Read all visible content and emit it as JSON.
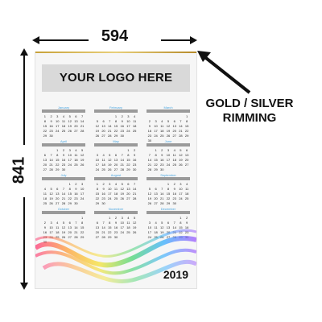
{
  "dimensions": {
    "width": "594",
    "height": "841"
  },
  "poster": {
    "logo_text": "YOUR LOGO HERE",
    "year": "2019",
    "rim_color": "#c8a23a",
    "months": [
      "January",
      "February",
      "March",
      "April",
      "May",
      "June",
      "July",
      "August",
      "September",
      "October",
      "November",
      "December"
    ]
  },
  "rim_label": {
    "line1": "GOLD / SILVER",
    "line2": "RIMMING"
  }
}
